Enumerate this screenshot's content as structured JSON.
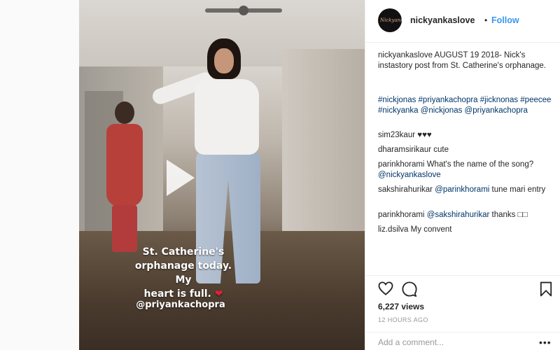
{
  "post": {
    "username": "nickyankaslove",
    "separator": "•",
    "follow_label": "Follow",
    "avatar_text": "Nickyanka"
  },
  "media": {
    "story_caption_line1": "St. Catherine's",
    "story_caption_line2": "orphanage today. My",
    "story_caption_line3": "heart is full.",
    "heart_glyph": "❤",
    "story_tag": "@priyankachopra"
  },
  "caption": {
    "username": "nickyankaslove",
    "text": "AUGUST 19 2018- Nick's instastory post from St. Catherine's orphanage.",
    "hashtags": "#nickjonas #priyankachopra #jicknonas #peecee #nickyanka @nickjonas @priyankachopra"
  },
  "comments": [
    {
      "username": "sim23kaur",
      "text": "♥♥♥"
    },
    {
      "username": "dharamsirikaur",
      "text": "cute"
    },
    {
      "username": "parinkhorami",
      "text": "What's the name of the song?",
      "mention": "@nickyankaslove"
    },
    {
      "username": "sakshirahurikar",
      "mention": "@parinkhorami",
      "text": "tune mari entry"
    },
    {
      "username": "parinkhorami",
      "mention": "@sakshirahurikar",
      "text": "thanks □□"
    },
    {
      "username": "liz.dsilva",
      "text": "My convent"
    }
  ],
  "stats": {
    "views": "6,227 views",
    "time": "12 HOURS AGO"
  },
  "add_comment": {
    "placeholder": "Add a comment...",
    "more": "•••"
  },
  "icons": {
    "like": "heart-icon",
    "comment": "comment-icon",
    "save": "bookmark-icon",
    "play": "play-icon"
  }
}
